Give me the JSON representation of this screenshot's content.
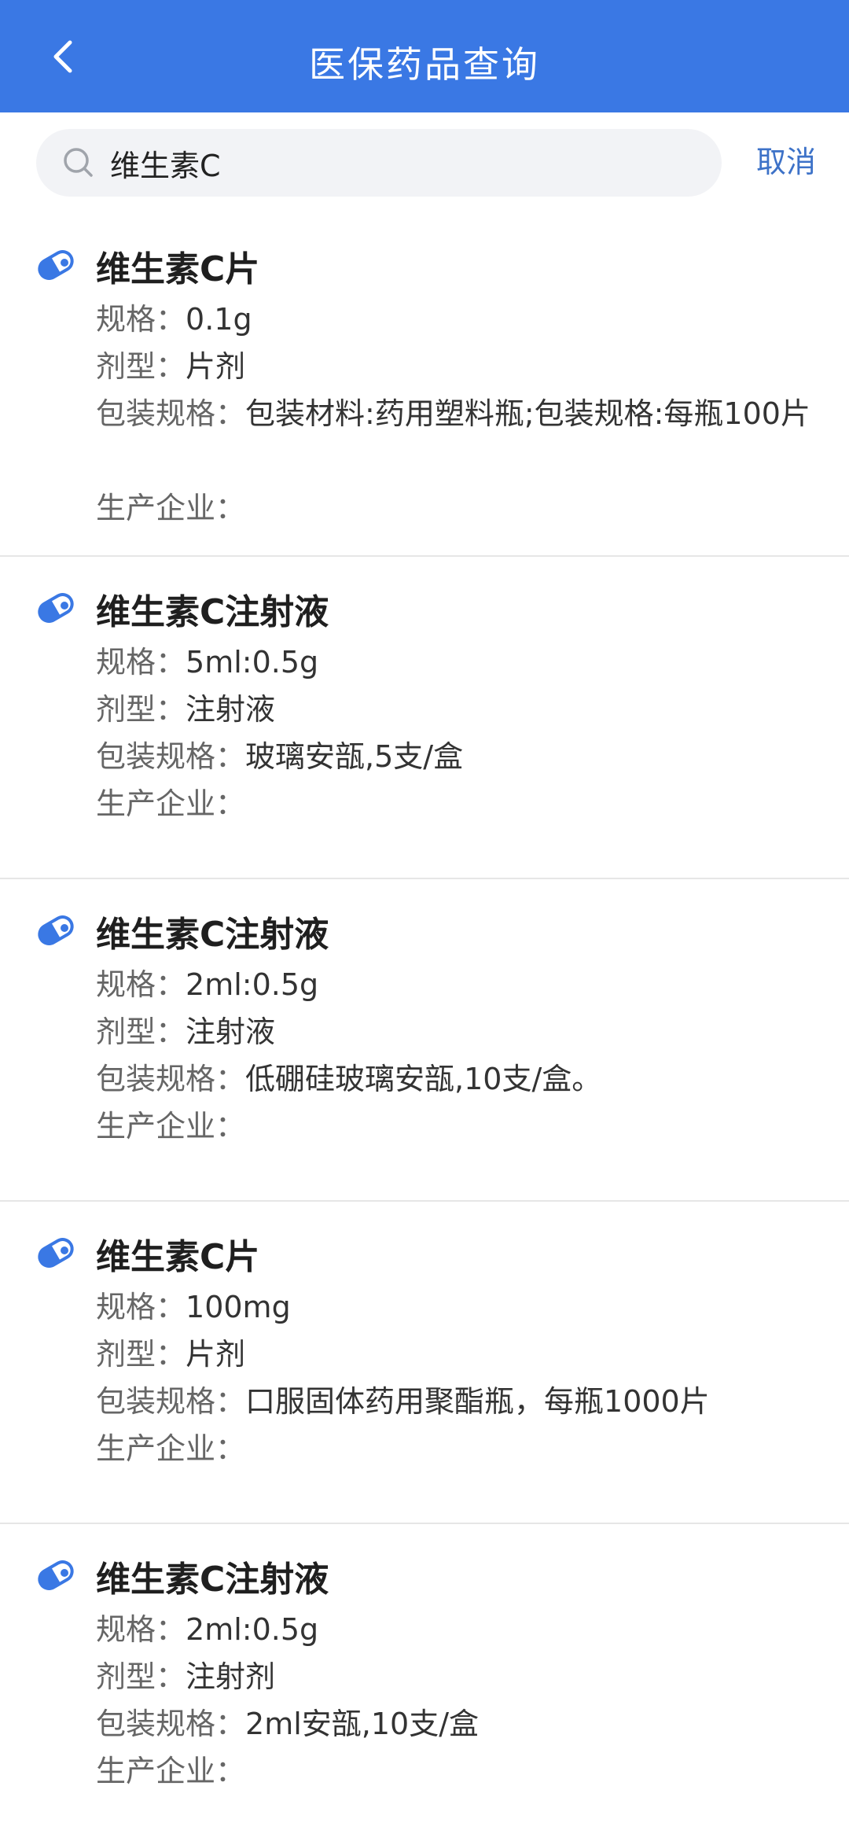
{
  "header": {
    "title": "医保药品查询"
  },
  "search": {
    "value": "维生素C",
    "cancel_label": "取消"
  },
  "labels": {
    "spec": "规格：",
    "dosage_form": "剂型：",
    "packaging": "包装规格：",
    "manufacturer": "生产企业："
  },
  "results": [
    {
      "name": "维生素C片",
      "spec": "0.1g",
      "dosage_form": "片剂",
      "packaging": "包装材料:药用塑料瓶;包装规格:每瓶100片",
      "manufacturer": ""
    },
    {
      "name": "维生素C注射液",
      "spec": "5ml:0.5g",
      "dosage_form": "注射液",
      "packaging": "玻璃安瓿,5支/盒",
      "manufacturer": ""
    },
    {
      "name": "维生素C注射液",
      "spec": "2ml:0.5g",
      "dosage_form": "注射液",
      "packaging": "低硼硅玻璃安瓿,10支/盒。",
      "manufacturer": ""
    },
    {
      "name": "维生素C片",
      "spec": "100mg",
      "dosage_form": "片剂",
      "packaging": "口服固体药用聚酯瓶，每瓶1000片",
      "manufacturer": ""
    },
    {
      "name": "维生素C注射液",
      "spec": "2ml:0.5g",
      "dosage_form": "注射剂",
      "packaging": "2ml安瓿,10支/盒",
      "manufacturer": ""
    }
  ],
  "colors": {
    "header_bg": "#3a78e4",
    "accent": "#3d72c8",
    "icon": "#3a78e4"
  },
  "icons": {
    "back": "chevron-left-icon",
    "search": "search-icon",
    "drug": "pill-icon"
  }
}
